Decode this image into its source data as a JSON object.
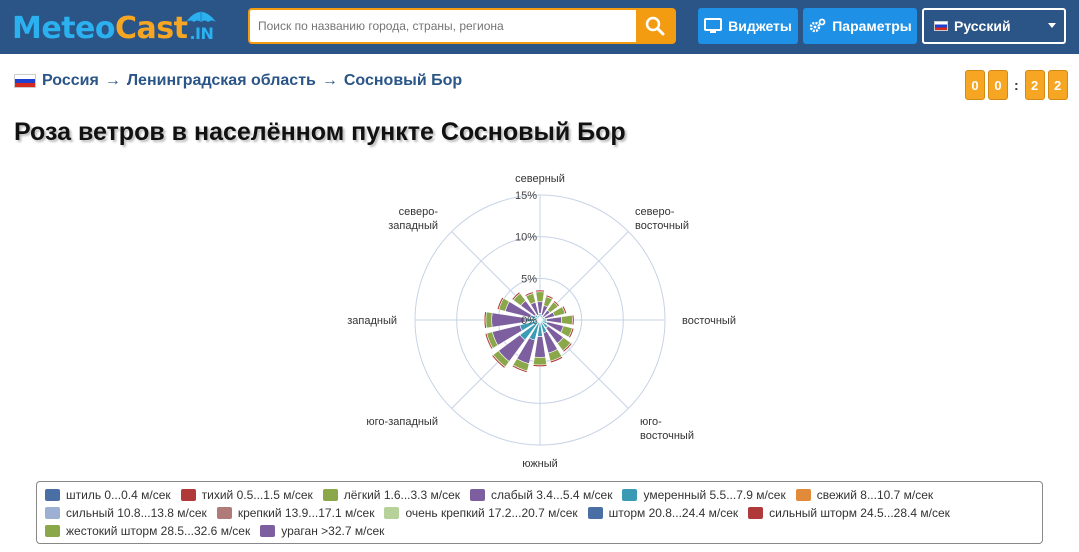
{
  "header": {
    "logo_meteo": "Meteo",
    "logo_cast": "Cast",
    "logo_in": ".IN",
    "search_placeholder": "Поиск по названию города, страны, региона",
    "widgets_label": "Виджеты",
    "params_label": "Параметры",
    "language_label": "Русский"
  },
  "breadcrumb": {
    "country": "Россия",
    "region": "Ленинградская область",
    "city": "Сосновый Бор",
    "separator": "→"
  },
  "timer": {
    "digits": [
      "0",
      "0",
      "2",
      "2"
    ],
    "separator": ":"
  },
  "page_title": "Роза ветров в населённом пункте Сосновый Бор",
  "chart_data": {
    "type": "wind-rose",
    "direction_labels": [
      "северный",
      "северо-восточный",
      "восточный",
      "юго-восточный",
      "южный",
      "юго-западный",
      "западный",
      "северо-западный"
    ],
    "radial_ticks": [
      "0%",
      "5%",
      "10%",
      "15%"
    ],
    "rmax": 15,
    "directions_deg": [
      0,
      22.5,
      45,
      67.5,
      90,
      112.5,
      135,
      157.5,
      180,
      202.5,
      225,
      247.5,
      270,
      292.5,
      315,
      337.5
    ],
    "series": [
      {
        "name": "умеренный 5.5...7.9 м/сек",
        "color": "#3b9bb5",
        "values": [
          0.8,
          0.6,
          0.5,
          0.6,
          0.8,
          0.9,
          1.2,
          1.6,
          2.0,
          2.5,
          3.0,
          2.5,
          1.8,
          1.2,
          0.8,
          0.6
        ]
      },
      {
        "name": "слабый 3.4...5.4 м/сек",
        "color": "#7d5fa0",
        "values": [
          1.4,
          1.2,
          1.0,
          1.2,
          1.8,
          2.0,
          2.3,
          2.5,
          2.5,
          2.9,
          3.2,
          3.4,
          4.0,
          3.1,
          2.1,
          1.6
        ]
      },
      {
        "name": "лёгкий 1.6...3.3 м/сек",
        "color": "#8aa84a",
        "values": [
          1.2,
          1.1,
          1.2,
          1.3,
          1.3,
          1.1,
          1.1,
          1.0,
          0.9,
          0.9,
          0.8,
          0.7,
          0.7,
          0.8,
          1.1,
          1.1
        ]
      },
      {
        "name": "тихий 0.5...1.5 м/сек",
        "color": "#b03a3a",
        "values": [
          0.2,
          0.2,
          0.2,
          0.2,
          0.2,
          0.2,
          0.2,
          0.2,
          0.2,
          0.2,
          0.2,
          0.2,
          0.2,
          0.2,
          0.2,
          0.2
        ]
      }
    ],
    "legend": [
      {
        "label": "штиль 0...0.4 м/сек",
        "color": "#4a6fa5"
      },
      {
        "label": "тихий 0.5...1.5 м/сек",
        "color": "#b03a3a"
      },
      {
        "label": "лёгкий 1.6...3.3 м/сек",
        "color": "#8aa84a"
      },
      {
        "label": "слабый 3.4...5.4 м/сек",
        "color": "#7d5fa0"
      },
      {
        "label": "умеренный 5.5...7.9 м/сек",
        "color": "#3b9bb5"
      },
      {
        "label": "свежий 8...10.7 м/сек",
        "color": "#e08a3a"
      },
      {
        "label": "сильный 10.8...13.8 м/сек",
        "color": "#9db0d4"
      },
      {
        "label": "крепкий 13.9...17.1 м/сек",
        "color": "#b07a78"
      },
      {
        "label": "очень крепкий 17.2...20.7 м/сек",
        "color": "#b7d19a"
      },
      {
        "label": "шторм 20.8...24.4 м/сек",
        "color": "#4a6fa5"
      },
      {
        "label": "сильный шторм 24.5...28.4 м/сек",
        "color": "#b03a3a"
      },
      {
        "label": "жестокий шторм 28.5...32.6 м/сек",
        "color": "#8aa84a"
      },
      {
        "label": "ураган >32.7 м/сек",
        "color": "#7d5fa0"
      }
    ]
  }
}
